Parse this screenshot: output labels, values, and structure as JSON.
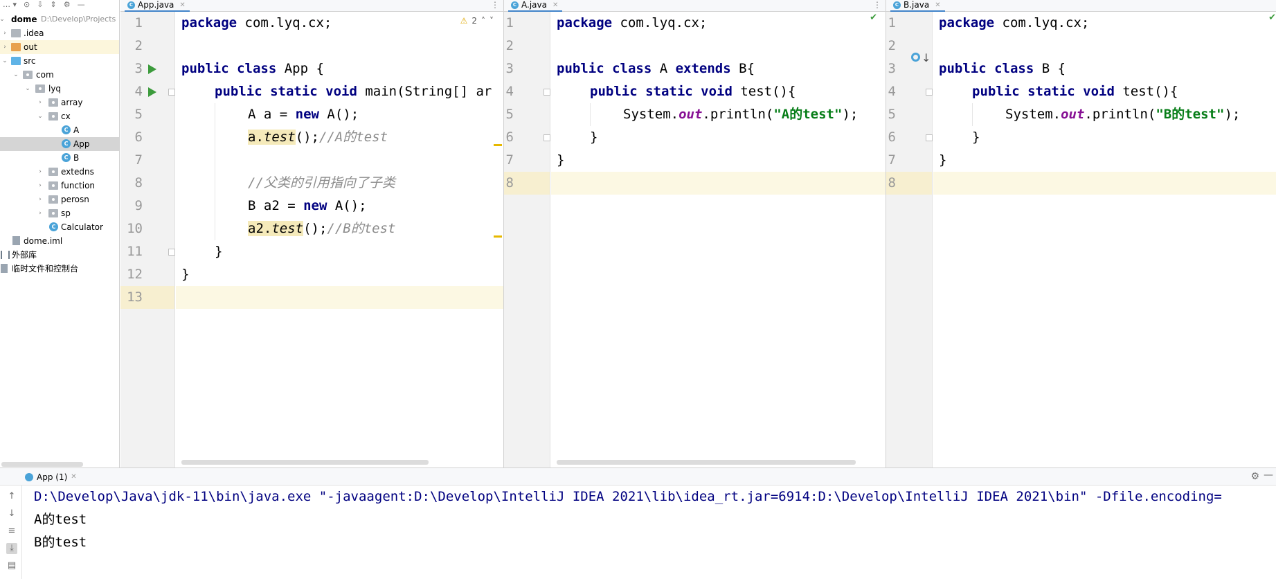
{
  "project": {
    "toolbar_icons": [
      "dropdown-icon",
      "locate-icon",
      "expand-all-icon",
      "collapse-all-icon",
      "settings-icon",
      "hide-icon"
    ],
    "root_name": "dome",
    "root_path": "D:\\Develop\\Projects",
    "items": [
      {
        "label": ".idea"
      },
      {
        "label": "out"
      },
      {
        "label": "src"
      },
      {
        "label": "com"
      },
      {
        "label": "lyq"
      },
      {
        "label": "array"
      },
      {
        "label": "cx"
      },
      {
        "label": "A"
      },
      {
        "label": "App"
      },
      {
        "label": "B"
      },
      {
        "label": "extedns"
      },
      {
        "label": "function"
      },
      {
        "label": "perosn"
      },
      {
        "label": "sp"
      },
      {
        "label": "Calculator"
      },
      {
        "label": "dome.iml"
      },
      {
        "label": "外部库"
      },
      {
        "label": "临时文件和控制台"
      }
    ]
  },
  "editors": {
    "app": {
      "tab": "App.java",
      "warnings": "2",
      "lines": {
        "l1": [
          "package",
          " com.lyq.cx;"
        ],
        "l3": [
          "public class",
          " App {"
        ],
        "l4": [
          "public static void",
          " main(String[] ar"
        ],
        "l5": [
          "A a = ",
          "new",
          " A();"
        ],
        "l6": [
          "a.",
          "test",
          "();",
          "//A的test"
        ],
        "l8": "//父类的引用指向了子类",
        "l9": [
          "B a2 = ",
          "new",
          " A();"
        ],
        "l10": [
          "a2.",
          "test",
          "();",
          "//B的test"
        ],
        "l11": "}",
        "l12": "}"
      }
    },
    "a": {
      "tab": "A.java",
      "lines": {
        "l1": [
          "package",
          " com.lyq.cx;"
        ],
        "l3": [
          "public class",
          " A ",
          "extends",
          " B{"
        ],
        "l4": [
          "public static void",
          " test(){"
        ],
        "l5": [
          "System.",
          "out",
          ".println(",
          "\"A的test\"",
          ");"
        ],
        "l6": "}",
        "l7": "}"
      }
    },
    "b": {
      "tab": "B.java",
      "lines": {
        "l1": [
          "package",
          " com.lyq.cx;"
        ],
        "l3": [
          "public class",
          " B {"
        ],
        "l4": [
          "public static void",
          " test(){"
        ],
        "l5": [
          "System.",
          "out",
          ".println(",
          "\"B的test\"",
          ");"
        ],
        "l6": "}",
        "l7": "}"
      }
    },
    "line_numbers_app": [
      "1",
      "2",
      "3",
      "4",
      "5",
      "6",
      "7",
      "8",
      "9",
      "10",
      "11",
      "12",
      "13"
    ],
    "line_numbers_ab": [
      "1",
      "2",
      "3",
      "4",
      "5",
      "6",
      "7",
      "8"
    ]
  },
  "run": {
    "tab": "App (1)",
    "output": [
      "D:\\Develop\\Java\\jdk-11\\bin\\java.exe \"-javaagent:D:\\Develop\\IntelliJ IDEA 2021\\lib\\idea_rt.jar=6914:D:\\Develop\\IntelliJ IDEA 2021\\bin\" -Dfile.encoding=",
      "A的test",
      "B的test"
    ]
  },
  "colors": {
    "keyword": "#000080",
    "string": "#067d17",
    "static_field": "#871094",
    "comment": "#8c8c8c",
    "current_line": "#fcf8e3"
  }
}
